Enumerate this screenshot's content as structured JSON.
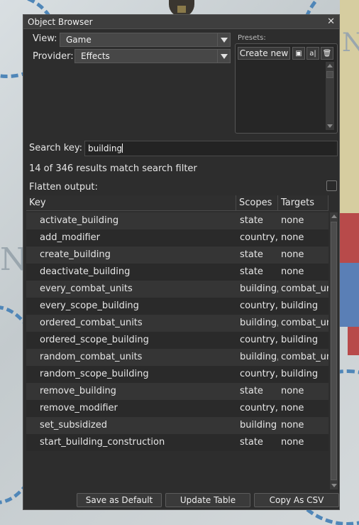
{
  "window": {
    "title": "Object Browser"
  },
  "view": {
    "label": "View:",
    "value": "Game"
  },
  "provider": {
    "label": "Provider:",
    "value": "Effects"
  },
  "presets": {
    "label": "Presets:",
    "create_label": "Create new",
    "save_icon": "save-icon",
    "rename_icon": "rename-icon",
    "delete_icon": "trash-icon"
  },
  "search": {
    "label": "Search key:",
    "value": "building"
  },
  "results_text": "14 of 346 results match search filter",
  "flatten": {
    "label": "Flatten output:",
    "checked": false
  },
  "table": {
    "headers": [
      "Key",
      "Scopes",
      "Targets"
    ],
    "rows": [
      {
        "key": "activate_building",
        "scopes": "state",
        "targets": "none"
      },
      {
        "key": "add_modifier",
        "scopes": "country, s",
        "targets": "none"
      },
      {
        "key": "create_building",
        "scopes": "state",
        "targets": "none"
      },
      {
        "key": "deactivate_building",
        "scopes": "state",
        "targets": "none"
      },
      {
        "key": "every_combat_units",
        "scopes": "building, c",
        "targets": "combat_ur"
      },
      {
        "key": "every_scope_building",
        "scopes": "country, s",
        "targets": "building"
      },
      {
        "key": "ordered_combat_units",
        "scopes": "building, c",
        "targets": "combat_ur"
      },
      {
        "key": "ordered_scope_building",
        "scopes": "country, s",
        "targets": "building"
      },
      {
        "key": "random_combat_units",
        "scopes": "building, c",
        "targets": "combat_ur"
      },
      {
        "key": "random_scope_building",
        "scopes": "country, s",
        "targets": "building"
      },
      {
        "key": "remove_building",
        "scopes": "state",
        "targets": "none"
      },
      {
        "key": "remove_modifier",
        "scopes": "country, s",
        "targets": "none"
      },
      {
        "key": "set_subsidized",
        "scopes": "building",
        "targets": "none"
      },
      {
        "key": "start_building_construction",
        "scopes": "state",
        "targets": "none"
      }
    ]
  },
  "buttons": {
    "save_default": "Save as Default",
    "update_table": "Update Table",
    "copy_csv": "Copy As CSV"
  },
  "colors": {
    "window_bg": "#2d2d2d",
    "map_border_dash": "#4f86b8"
  }
}
